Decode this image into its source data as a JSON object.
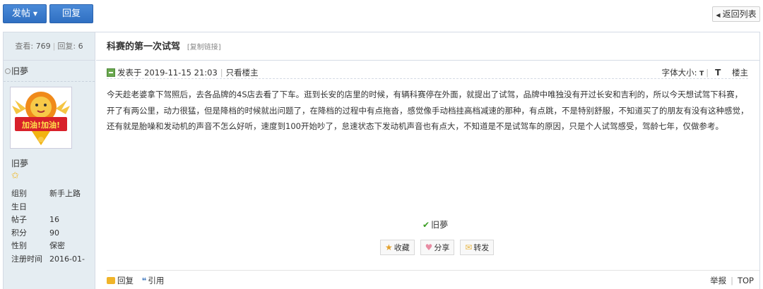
{
  "toolbar": {
    "post_label": "发帖",
    "reply_label": "回复",
    "back_label": "返回列表"
  },
  "thread": {
    "views_label": "查看:",
    "views": "769",
    "replies_label": "回复:",
    "replies": "6",
    "title": "科赛的第一次试驾",
    "copy_link": "[复制链接]"
  },
  "author": {
    "name": "旧夢",
    "info": [
      {
        "key": "组别",
        "value": "新手上路"
      },
      {
        "key": "生日",
        "value": ""
      },
      {
        "key": "帖子",
        "value": "16"
      },
      {
        "key": "积分",
        "value": "90"
      },
      {
        "key": "性别",
        "value": "保密"
      },
      {
        "key": "注册时间",
        "value": "2016-01-"
      }
    ]
  },
  "post": {
    "posted": "发表于 2019-11-15 21:03",
    "only_author": "只看楼主",
    "font_size_label": "字体大小:",
    "font_small": "T",
    "font_big": "T",
    "floor": "楼主",
    "body": "今天趁老婆拿下驾照后，去各品牌的4S店去看了下车。逛到长安的店里的时候，有辆科赛停在外面，就提出了试驾，品牌中唯独没有开过长安和吉利的，所以今天想试驾下科赛，开了有两公里，动力很猛，但是降档的时候就出问题了，在降档的过程中有点拖沓，感觉像手动档挂高档减速的那种，有点跳，不是特别舒服，不知道买了的朋友有没有这种感觉，还有就是胎噪和发动机的声音不怎么好听，速度到100开始吵了，怠速状态下发动机声音也有点大，不知道是不是试驾车的原因，只是个人试驾感受，驾龄七年，仅做参考。",
    "signature": "旧夢",
    "actions": {
      "favorite": "收藏",
      "share": "分享",
      "forward": "转发"
    }
  },
  "footer": {
    "reply": "回复",
    "quote": "引用",
    "report": "举报",
    "top": "TOP"
  },
  "avatar": {
    "text": "加油!加油!"
  },
  "colors": {
    "primary_button": "#3a7bd0",
    "sidebar_bg": "#e5edf2",
    "border": "#d5dbe5"
  }
}
